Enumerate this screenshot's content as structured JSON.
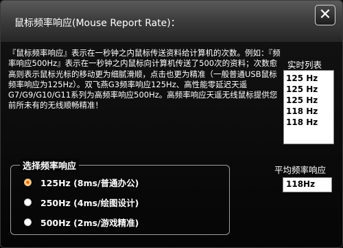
{
  "window": {
    "title": "鼠标频率响应(Mouse Report Rate)：",
    "close_glyph": "✕"
  },
  "description": "『鼠标频率响应』表示在一秒钟之内鼠标传送资料给计算机的次数。例如：『频率响应500Hz』表示在一秒钟之内鼠标向计算机传送了500次的资料；次数愈高则表示鼠标光标的移动更为细腻滑顺，点击也更为精准（一般普通USB鼠标频率响应为125Hz）。双飞燕G3频率响应125Hz、高性能零延迟天遥G7/G9/G10/G11系列为高频率响应500Hz。高频率响应天遥无线鼠标提供您前所未有的无线顺畅精准！",
  "realtime": {
    "label": "实时列表",
    "items": [
      "125 Hz",
      "125 Hz",
      "125 Hz",
      "118 Hz",
      "118 Hz"
    ]
  },
  "average": {
    "label": "平均频率响应",
    "value": "118Hz"
  },
  "rate_group": {
    "legend": "选择频率响应",
    "options": [
      {
        "label": "125Hz (8ms/普通办公)",
        "selected": true
      },
      {
        "label": "250Hz (4ms/绘图设计)",
        "selected": false
      },
      {
        "label": "500Hz (2ms/游戏精准)",
        "selected": false
      }
    ]
  },
  "colors": {
    "background": "#0a0a0a",
    "selected_radio": "#e8751a",
    "text": "#ffffff"
  }
}
